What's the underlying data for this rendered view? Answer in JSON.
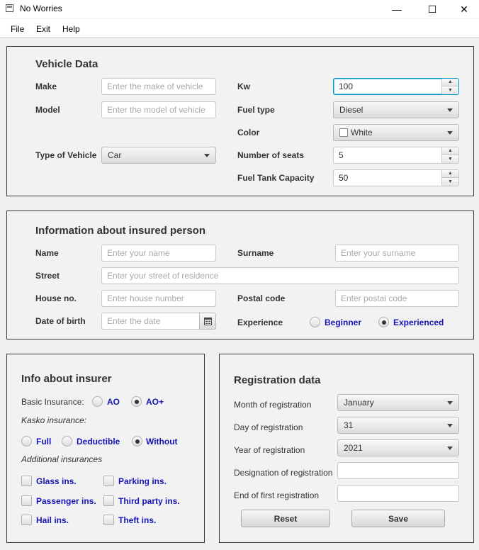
{
  "window": {
    "title": "No Worries",
    "minimize": "—",
    "maximize": "☐",
    "close": "✕"
  },
  "menu": [
    "File",
    "Exit",
    "Help"
  ],
  "vehicle": {
    "title": "Vehicle Data",
    "make_label": "Make",
    "make_placeholder": "Enter the make of vehicle",
    "model_label": "Model",
    "model_placeholder": "Enter the model of vehicle",
    "type_label": "Type of Vehicle",
    "type_value": "Car",
    "kw_label": "Kw",
    "kw_value": "100",
    "fuel_label": "Fuel type",
    "fuel_value": "Diesel",
    "color_label": "Color",
    "color_value": "White",
    "seats_label": "Number of seats",
    "seats_value": "5",
    "tank_label": "Fuel Tank Capacity",
    "tank_value": "50"
  },
  "person": {
    "title": "Information about insured person",
    "name_label": "Name",
    "name_placeholder": "Enter your name",
    "surname_label": "Surname",
    "surname_placeholder": "Enter your surname",
    "street_label": "Street",
    "street_placeholder": "Enter your street of residence",
    "house_label": "House no.",
    "house_placeholder": "Enter house number",
    "postal_label": "Postal code",
    "postal_placeholder": "Enter postal code",
    "dob_label": "Date of birth",
    "dob_placeholder": "Enter the date",
    "exp_label": "Experience",
    "exp_options": [
      "Beginner",
      "Experienced"
    ],
    "exp_selected": "Experienced"
  },
  "insurer": {
    "title": "Info about insurer",
    "basic_label": "Basic Insurance:",
    "basic_options": [
      "AO",
      "AO+"
    ],
    "basic_selected": "AO+",
    "kasko_label": "Kasko insurance:",
    "kasko_options": [
      "Full",
      "Deductible",
      "Without"
    ],
    "kasko_selected": "Without",
    "additional_label": "Additional insurances",
    "additional": [
      "Glass ins.",
      "Parking ins.",
      "Passenger ins.",
      "Third party ins.",
      "Hail ins.",
      "Theft ins."
    ]
  },
  "registration": {
    "title": "Registration data",
    "month_label": "Month of registration",
    "month_value": "January",
    "day_label": "Day of registration",
    "day_value": "31",
    "year_label": "Year of registration",
    "year_value": "2021",
    "designation_label": "Designation of registration",
    "designation_value": "",
    "end_label": "End of first registration",
    "end_value": "",
    "reset_label": "Reset",
    "save_label": "Save"
  }
}
